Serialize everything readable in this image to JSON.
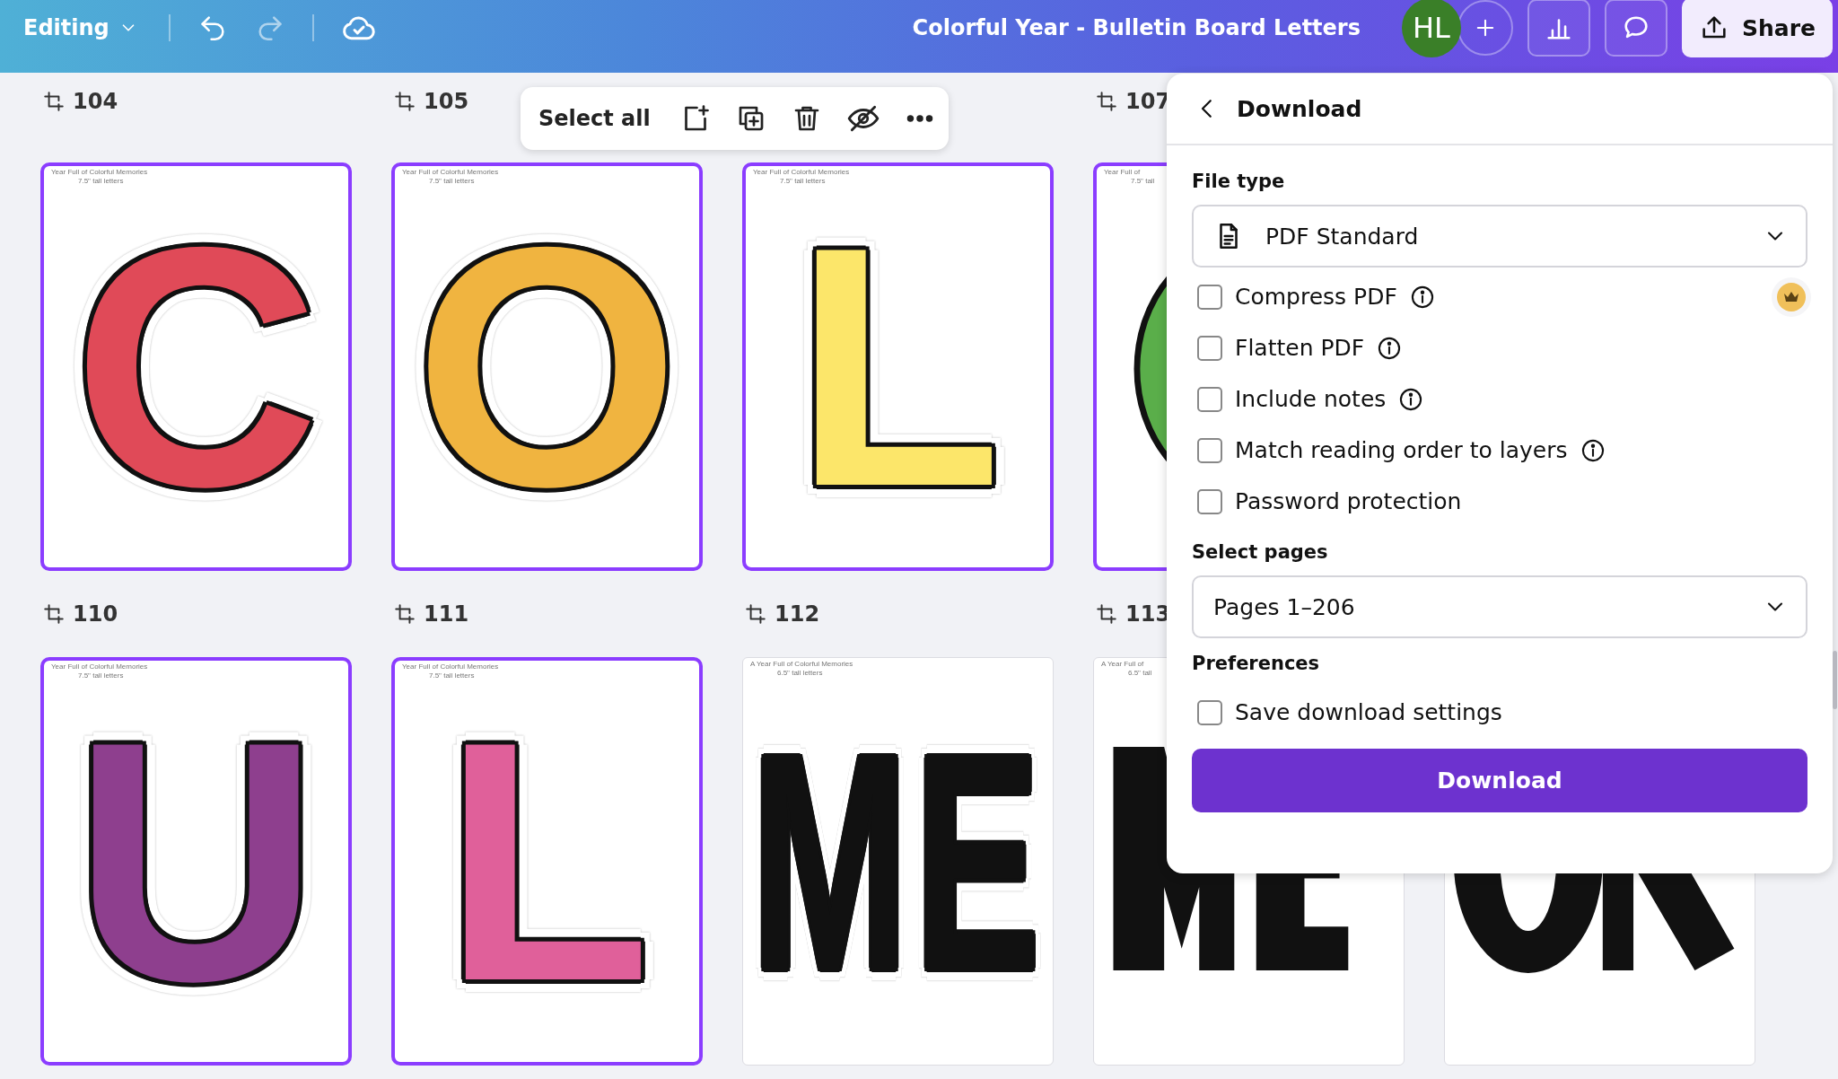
{
  "top_bar": {
    "mode_menu": "Editing",
    "title": "Colorful Year - Bulletin Board Letters",
    "avatar": "HL",
    "share": "Share"
  },
  "toolbar": {
    "select_all": "Select all"
  },
  "canvas": {
    "numbers_above": [
      {
        "label": "104"
      },
      {
        "label": "105"
      },
      {
        "label": "107"
      }
    ],
    "rows": [
      {
        "pages": [
          {
            "selected": true,
            "header": "Year Full of Colorful Memories",
            "subheader": "7.5\" tall letters",
            "kind": "letters",
            "letters": "C",
            "color": "#e04a58",
            "number": "110"
          },
          {
            "selected": true,
            "header": "Year Full of Colorful Memories",
            "subheader": "7.5\" tall letters",
            "kind": "letters",
            "letters": "O",
            "color": "#f0b440",
            "number": "111"
          },
          {
            "selected": true,
            "header": "Year Full of Colorful Memories",
            "subheader": "7.5\" tall letters",
            "kind": "letters",
            "letters": "L",
            "color": "#fce66a",
            "number": "112"
          },
          {
            "selected": true,
            "header": "Year Full of",
            "subheader": "7.5\" tall",
            "kind": "ring",
            "color": "#5aae4a",
            "number": "113"
          }
        ]
      },
      {
        "pages": [
          {
            "selected": true,
            "header": "Year Full of Colorful Memories",
            "subheader": "7.5\" tall letters",
            "kind": "letters",
            "letters": "U",
            "color": "#8e3f8e"
          },
          {
            "selected": true,
            "header": "Year Full of Colorful Memories",
            "subheader": "7.5\" tall letters",
            "kind": "letters",
            "letters": "L",
            "color": "#e0609a"
          },
          {
            "selected": false,
            "header": "A Year Full of Colorful Memories",
            "subheader": "6.5\" tall letters",
            "kind": "letters",
            "letters": "ME",
            "color": "#111111"
          },
          {
            "selected": false,
            "header": "A Year Full of",
            "subheader": "6.5\" tall",
            "kind": "bars",
            "color": "#111111"
          },
          {
            "selected": false,
            "kind": "ring_bars",
            "color": "#111111"
          }
        ]
      }
    ]
  },
  "download_panel": {
    "title": "Download",
    "file_type": {
      "label": "File type",
      "value": "PDF Standard"
    },
    "options": [
      {
        "label": "Compress PDF",
        "checked": false,
        "info": true,
        "premium": true
      },
      {
        "label": "Flatten PDF",
        "checked": false,
        "info": true,
        "premium": false
      },
      {
        "label": "Include notes",
        "checked": false,
        "info": true,
        "premium": false
      },
      {
        "label": "Match reading order to layers",
        "checked": false,
        "info": true,
        "premium": false
      },
      {
        "label": "Password protection",
        "checked": false,
        "info": false,
        "premium": false
      }
    ],
    "select_pages": {
      "label": "Select pages",
      "value": "Pages 1–206"
    },
    "preferences": {
      "label": "Preferences",
      "options": [
        {
          "label": "Save download settings",
          "checked": false
        }
      ]
    },
    "button": "Download"
  }
}
